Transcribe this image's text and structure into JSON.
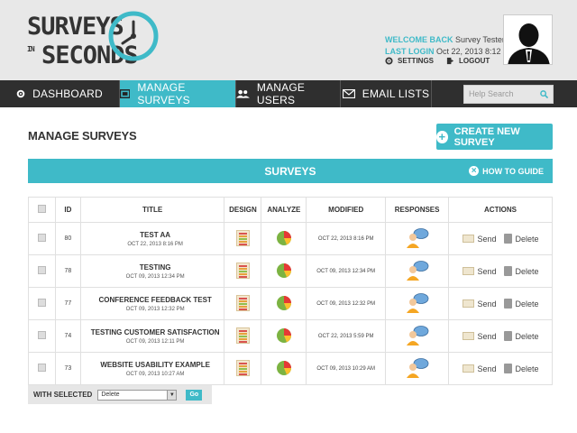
{
  "logo": {
    "line1": "SURVEYS",
    "small": "IN",
    "line2": "SECONDS"
  },
  "user": {
    "welcome_label": "WELCOME BACK",
    "name": "Survey Tester",
    "last_login_label": "LAST LOGIN",
    "last_login_value": "Oct 22, 2013 8:12 PM",
    "settings_label": "SETTINGS",
    "logout_label": "LOGOUT"
  },
  "nav": {
    "items": [
      {
        "label": "DASHBOARD",
        "icon": "gear-icon"
      },
      {
        "label": "MANAGE SURVEYS",
        "icon": "survey-icon"
      },
      {
        "label": "MANAGE USERS",
        "icon": "users-icon"
      },
      {
        "label": "EMAIL LISTS",
        "icon": "email-icon"
      }
    ],
    "active": "MANAGE SURVEYS",
    "search_placeholder": "Help Search"
  },
  "page": {
    "title": "MANAGE SURVEYS",
    "create_button": "CREATE NEW SURVEY",
    "panel_title": "SURVEYS",
    "howto_label": "HOW TO GUIDE"
  },
  "table": {
    "headers": [
      "ID",
      "TITLE",
      "DESIGN",
      "ANALYZE",
      "MODIFIED",
      "RESPONSES",
      "ACTIONS"
    ],
    "rows": [
      {
        "id": "80",
        "title": "TEST AA",
        "created": "OCT 22, 2013 8:16 PM",
        "modified": "OCT 22, 2013 8:16 PM"
      },
      {
        "id": "78",
        "title": "TESTING",
        "created": "OCT 09, 2013 12:34 PM",
        "modified": "OCT 09, 2013 12:34 PM"
      },
      {
        "id": "77",
        "title": "CONFERENCE FEEDBACK TEST",
        "created": "OCT 09, 2013 12:32 PM",
        "modified": "OCT 09, 2013 12:32 PM"
      },
      {
        "id": "74",
        "title": "TESTING CUSTOMER SATISFACTION",
        "created": "OCT 09, 2013 12:11 PM",
        "modified": "OCT 22, 2013 5:59 PM"
      },
      {
        "id": "73",
        "title": "WEBSITE USABILITY EXAMPLE",
        "created": "OCT 09, 2013 10:27 AM",
        "modified": "OCT 09, 2013 10:29 AM"
      }
    ],
    "send_label": "Send",
    "delete_label": "Delete"
  },
  "bulk": {
    "label": "WITH SELECTED",
    "selected_option": "Delete",
    "go_label": "Go"
  },
  "colors": {
    "accent": "#3fbac8",
    "nav_bg": "#2f2f2f",
    "header_bg": "#e8e8e8"
  }
}
